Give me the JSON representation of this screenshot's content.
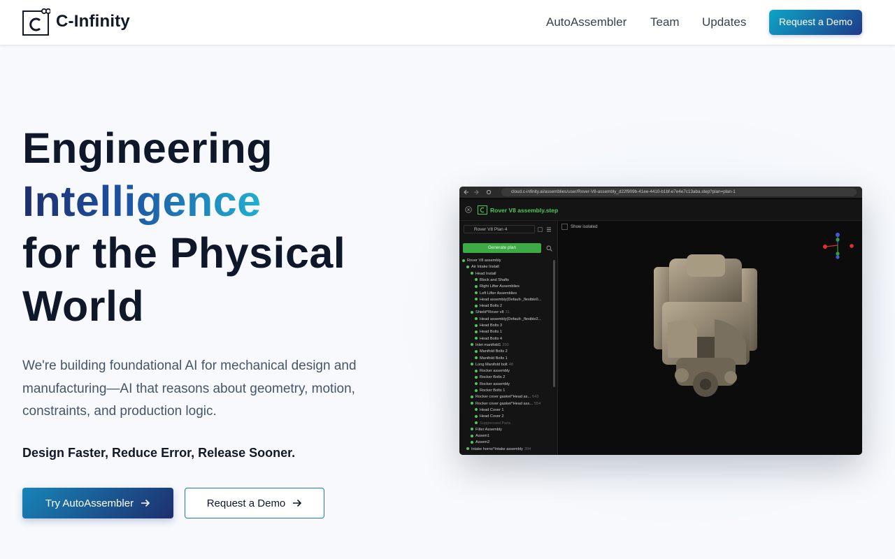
{
  "brand": {
    "name": "C-Infinity"
  },
  "nav": {
    "items": [
      "AutoAssembler",
      "Team",
      "Updates"
    ],
    "cta": "Request a Demo"
  },
  "hero": {
    "title_line1": "Engineering",
    "title_line2": "Intelligence",
    "title_line3": "for the Physical",
    "title_line4": "World",
    "subtitle": "We're building foundational AI for mechanical design and manufacturing—AI that reasons about geometry, motion, constraints, and production logic.",
    "tagline": "Design Faster, Reduce Error, Release Sooner.",
    "primary_cta": "Try AutoAssembler",
    "secondary_cta": "Request a Demo"
  },
  "app_preview": {
    "url": "cloud.c-infinity.ai/assemblies/user/Rover-V8-assembly_d22f909b-41ee-4410-b1bf-e7e4e7c13aba.step?plan=plan-1",
    "file_title": "Rover V8 assembly.step",
    "plan_selector": "Rover V8 Plan 4",
    "generate_button": "Generate plan",
    "show_isolated": "Show isolated",
    "tree": [
      {
        "label": "Rover V8 assembly",
        "num": ""
      },
      {
        "label": "Air Intake Install",
        "num": ""
      },
      {
        "label": "Head Install",
        "num": ""
      },
      {
        "label": "Block and Shafts",
        "num": ""
      },
      {
        "label": "Right Lifter Assemblies",
        "num": ""
      },
      {
        "label": "Left Lifter Assemblies",
        "num": ""
      },
      {
        "label": "Head assembly(Default-_flexible0...",
        "num": ""
      },
      {
        "label": "Head Bolts 2",
        "num": ""
      },
      {
        "label": "Shield^Rover v8",
        "num": "31"
      },
      {
        "label": "Head assembly(Default-_flexible2...",
        "num": ""
      },
      {
        "label": "Head Bolts 3",
        "num": ""
      },
      {
        "label": "Head Bolts 1",
        "num": ""
      },
      {
        "label": "Head Bolts 4",
        "num": ""
      },
      {
        "label": "Inlet manifold1",
        "num": "200"
      },
      {
        "label": "Manifold Bolts 2",
        "num": ""
      },
      {
        "label": "Manifold Bolts 1",
        "num": ""
      },
      {
        "label": "Long Manifold bolt",
        "num": "48"
      },
      {
        "label": "Rocker assembly",
        "num": ""
      },
      {
        "label": "Rocker Bolts 2",
        "num": ""
      },
      {
        "label": "Rocker assembly",
        "num": ""
      },
      {
        "label": "Rocker Bolts 1",
        "num": ""
      },
      {
        "label": "Rocker cover gasket^Head as...",
        "num": "643"
      },
      {
        "label": "Rocker cover gasket^Head ass...",
        "num": "554"
      },
      {
        "label": "Head Cover 1",
        "num": ""
      },
      {
        "label": "Head Cover 2",
        "num": ""
      },
      {
        "label": "Suppressed Parts",
        "num": ""
      },
      {
        "label": "Filter Assembly",
        "num": ""
      },
      {
        "label": "Assem1",
        "num": ""
      },
      {
        "label": "Assem2",
        "num": ""
      },
      {
        "label": "Intake horns^Intake assembly",
        "num": "394"
      }
    ]
  }
}
